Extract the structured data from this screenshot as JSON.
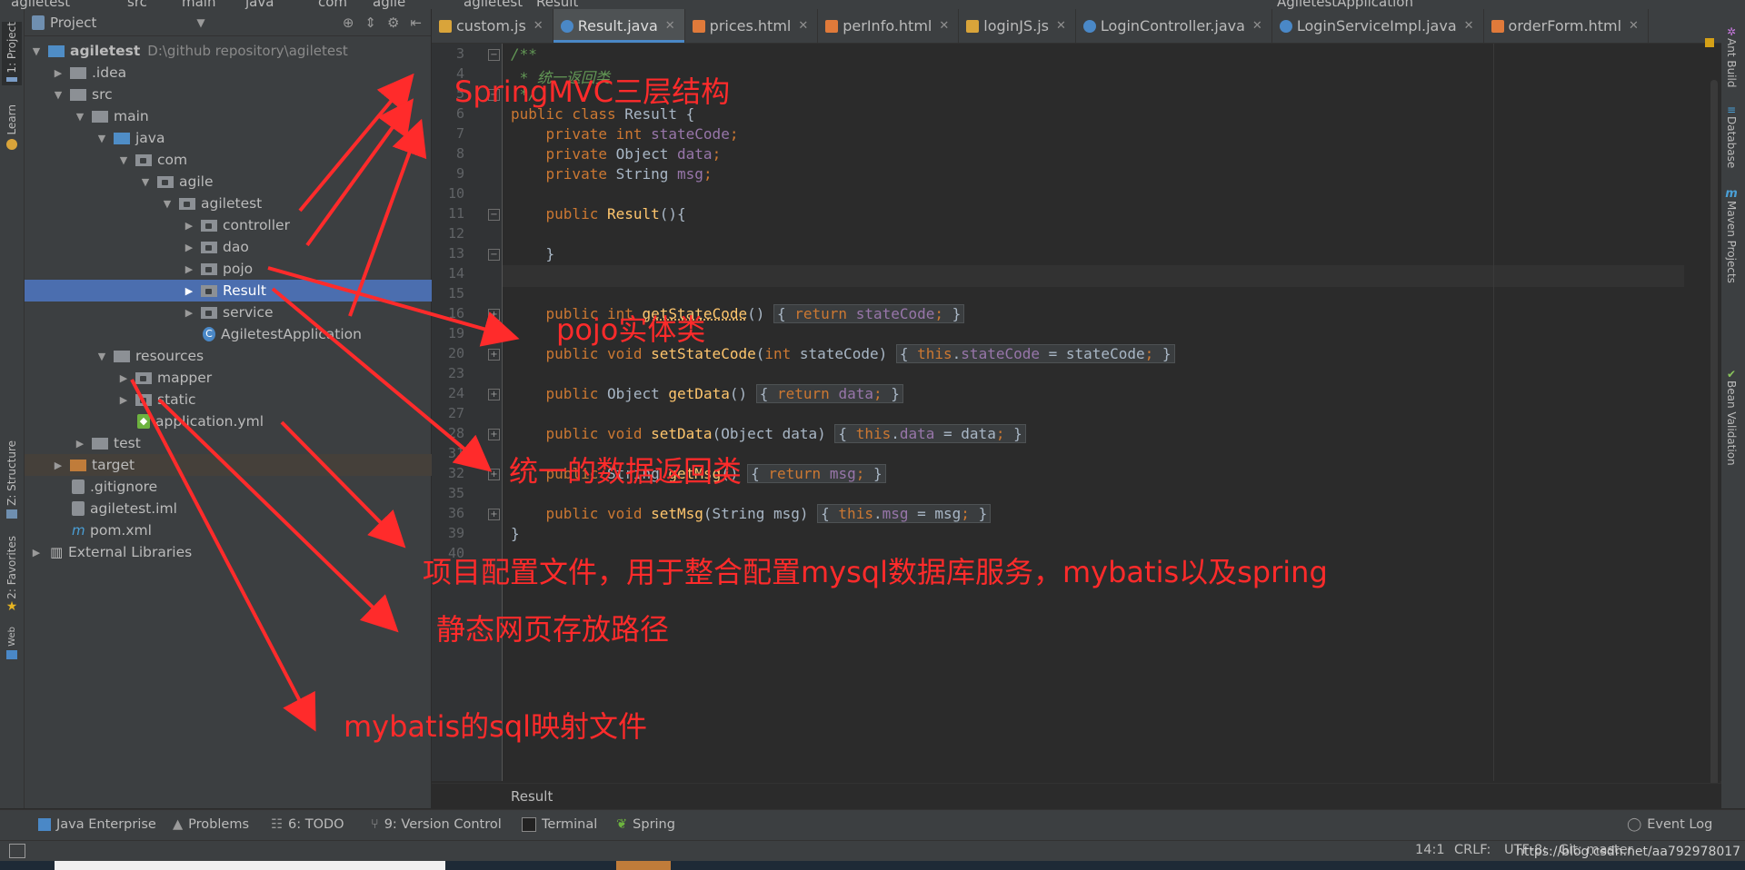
{
  "app": {
    "project_name": "agiletest",
    "project_path": "D:\\github repository\\agiletest",
    "breadcrumbs": [
      "src",
      "main",
      "java",
      "com",
      "agile",
      "agiletest",
      "Result"
    ],
    "run_config": "AgiletestApplication"
  },
  "left_strip": {
    "tabs": [
      {
        "id": "project",
        "label": "1: Project"
      },
      {
        "id": "learn",
        "label": "Learn"
      },
      {
        "id": "structure",
        "label": "Z: Structure"
      },
      {
        "id": "favorites",
        "label": "2: Favorites"
      },
      {
        "id": "web",
        "label": "Web"
      }
    ]
  },
  "right_strip": {
    "tabs": [
      {
        "id": "ant",
        "label": "Ant Build"
      },
      {
        "id": "database",
        "label": "Database"
      },
      {
        "id": "maven",
        "label": "Maven Projects"
      },
      {
        "id": "bean",
        "label": "Bean Validation"
      }
    ]
  },
  "project_panel": {
    "title": "Project",
    "tree": [
      {
        "label": "agiletest",
        "indent": 0,
        "arrow": "down",
        "icon": "folder-blue",
        "bold": true
      },
      {
        "label": ".idea",
        "indent": 1,
        "arrow": "right",
        "icon": "folder-gray"
      },
      {
        "label": "src",
        "indent": 1,
        "arrow": "down",
        "icon": "folder-gray"
      },
      {
        "label": "main",
        "indent": 2,
        "arrow": "down",
        "icon": "folder-gray"
      },
      {
        "label": "java",
        "indent": 3,
        "arrow": "down",
        "icon": "folder-blue"
      },
      {
        "label": "com",
        "indent": 4,
        "arrow": "down",
        "icon": "package"
      },
      {
        "label": "agile",
        "indent": 5,
        "arrow": "down",
        "icon": "package"
      },
      {
        "label": "agiletest",
        "indent": 6,
        "arrow": "down",
        "icon": "package"
      },
      {
        "label": "controller",
        "indent": 7,
        "arrow": "right",
        "icon": "package"
      },
      {
        "label": "dao",
        "indent": 7,
        "arrow": "right",
        "icon": "package"
      },
      {
        "label": "pojo",
        "indent": 7,
        "arrow": "right",
        "icon": "package"
      },
      {
        "label": "Result",
        "indent": 7,
        "arrow": "right",
        "icon": "package",
        "selected": true
      },
      {
        "label": "service",
        "indent": 7,
        "arrow": "right",
        "icon": "package"
      },
      {
        "label": "AgiletestApplication",
        "indent": 7,
        "arrow": "none",
        "icon": "spring-class"
      },
      {
        "label": "resources",
        "indent": 3,
        "arrow": "down",
        "icon": "folder-res"
      },
      {
        "label": "mapper",
        "indent": 4,
        "arrow": "right",
        "icon": "package"
      },
      {
        "label": "static",
        "indent": 4,
        "arrow": "right",
        "icon": "package"
      },
      {
        "label": "application.yml",
        "indent": 4,
        "arrow": "none",
        "icon": "yml"
      },
      {
        "label": "test",
        "indent": 2,
        "arrow": "right",
        "icon": "folder-gray"
      },
      {
        "label": "target",
        "indent": 1,
        "arrow": "right",
        "icon": "folder-orange",
        "highlight": true
      },
      {
        "label": ".gitignore",
        "indent": 1,
        "arrow": "none",
        "icon": "file"
      },
      {
        "label": "agiletest.iml",
        "indent": 1,
        "arrow": "none",
        "icon": "file"
      },
      {
        "label": "pom.xml",
        "indent": 1,
        "arrow": "none",
        "icon": "maven"
      },
      {
        "label": "External Libraries",
        "indent": 0,
        "arrow": "right",
        "icon": "libs"
      }
    ]
  },
  "editor_tabs": [
    {
      "label": "custom.js",
      "icon": "js"
    },
    {
      "label": "Result.java",
      "icon": "class",
      "active": true
    },
    {
      "label": "prices.html",
      "icon": "html"
    },
    {
      "label": "perInfo.html",
      "icon": "html"
    },
    {
      "label": "loginJS.js",
      "icon": "js"
    },
    {
      "label": "LoginController.java",
      "icon": "class"
    },
    {
      "label": "LoginServiceImpl.java",
      "icon": "class"
    },
    {
      "label": "orderForm.html",
      "icon": "html"
    }
  ],
  "editor": {
    "lines": [
      {
        "n": "3",
        "html": "<span class='cmt'>/**</span>",
        "fold": "-"
      },
      {
        "n": "4",
        "html": "<span class='cmt'> * 统一返回类</span>"
      },
      {
        "n": "5",
        "html": "<span class='cmt'> */</span>",
        "fold": "-"
      },
      {
        "n": "6",
        "html": "<span class='kw'>public class </span>Result {"
      },
      {
        "n": "7",
        "html": "    <span class='kw'>private int </span><span class='fld'>stateCode</span><span class='kw'>;</span>"
      },
      {
        "n": "8",
        "html": "    <span class='kw'>private </span>Object <span class='fld'>data</span><span class='kw'>;</span>"
      },
      {
        "n": "9",
        "html": "    <span class='kw'>private </span>String <span class='fld'>msg</span><span class='kw'>;</span>"
      },
      {
        "n": "10",
        "html": ""
      },
      {
        "n": "11",
        "html": "    <span class='kw'>public </span><span class='fn'>Result</span>(){",
        "fold": "-"
      },
      {
        "n": "12",
        "html": ""
      },
      {
        "n": "13",
        "html": "    }",
        "fold": "-"
      },
      {
        "n": "14",
        "html": ""
      },
      {
        "n": "15",
        "html": ""
      },
      {
        "n": "16",
        "html": "    <span class='kw'>public int </span><span class='fn' style='text-decoration:underline dotted'>getStateCode</span>() <span class='fbox'>{ <span class='kw'>return </span><span class='fld'>stateCode</span><span class='kw'>;</span> }</span>",
        "fold": "+"
      },
      {
        "n": "19",
        "html": ""
      },
      {
        "n": "20",
        "html": "    <span class='kw'>public void </span><span class='fn'>setStateCode</span>(<span class='kw'>int </span>stateCode) <span class='fbox'>{ <span class='kw'>this</span>.<span class='fld'>stateCode</span> = stateCode<span class='kw'>;</span> }</span>",
        "fold": "+"
      },
      {
        "n": "23",
        "html": ""
      },
      {
        "n": "24",
        "html": "    <span class='kw'>public </span>Object <span class='fn'>getData</span>() <span class='fbox'>{ <span class='kw'>return </span><span class='fld'>data</span><span class='kw'>;</span> }</span>",
        "fold": "+"
      },
      {
        "n": "27",
        "html": ""
      },
      {
        "n": "28",
        "html": "    <span class='kw'>public void </span><span class='fn'>setData</span>(Object data) <span class='fbox'>{ <span class='kw'>this</span>.<span class='fld'>data</span> = data<span class='kw'>;</span> }</span>",
        "fold": "+"
      },
      {
        "n": "31",
        "html": ""
      },
      {
        "n": "32",
        "html": "    <span class='kw'>public </span>String <span class='fn'>getMsg</span>() <span class='fbox'>{ <span class='kw'>return </span><span class='fld'>msg</span><span class='kw'>;</span> }</span>",
        "fold": "+"
      },
      {
        "n": "35",
        "html": ""
      },
      {
        "n": "36",
        "html": "    <span class='kw'>public void </span><span class='fn'>setMsg</span>(String msg) <span class='fbox'>{ <span class='kw'>this</span>.<span class='fld'>msg</span> = msg<span class='kw'>;</span> }</span>",
        "fold": "+"
      },
      {
        "n": "39",
        "html": "}"
      },
      {
        "n": "40",
        "html": ""
      }
    ],
    "breadcrumb": "Result"
  },
  "bottom_tools": [
    {
      "id": "java-enterprise",
      "label": "Java Enterprise"
    },
    {
      "id": "problems",
      "label": "Problems"
    },
    {
      "id": "todo",
      "label": "6: TODO"
    },
    {
      "id": "vcs",
      "label": "9: Version Control"
    },
    {
      "id": "terminal",
      "label": "Terminal"
    },
    {
      "id": "spring",
      "label": "Spring"
    },
    {
      "id": "event-log",
      "label": "Event Log"
    }
  ],
  "status": {
    "position": "14:1",
    "line_sep": "CRLF:",
    "encoding": "UTF-8:",
    "vcs": "Git: master",
    "watermark": "https://blog.csdn.net/aa792978017"
  },
  "annotations": [
    {
      "id": "springmvc",
      "text": "SpringMVC三层结构"
    },
    {
      "id": "pojo",
      "text": "pojo实体类"
    },
    {
      "id": "result",
      "text": "统一的数据返回类"
    },
    {
      "id": "yml",
      "text": "项目配置文件，用于整合配置mysql数据库服务，mybatis以及spring"
    },
    {
      "id": "static",
      "text": "静态网页存放路径"
    },
    {
      "id": "mapper",
      "text": "mybatis的sql映射文件"
    }
  ],
  "colors": {
    "annotation": "#ff2b2b",
    "selection": "#4b6eaf",
    "accent": "#4a88c7"
  }
}
